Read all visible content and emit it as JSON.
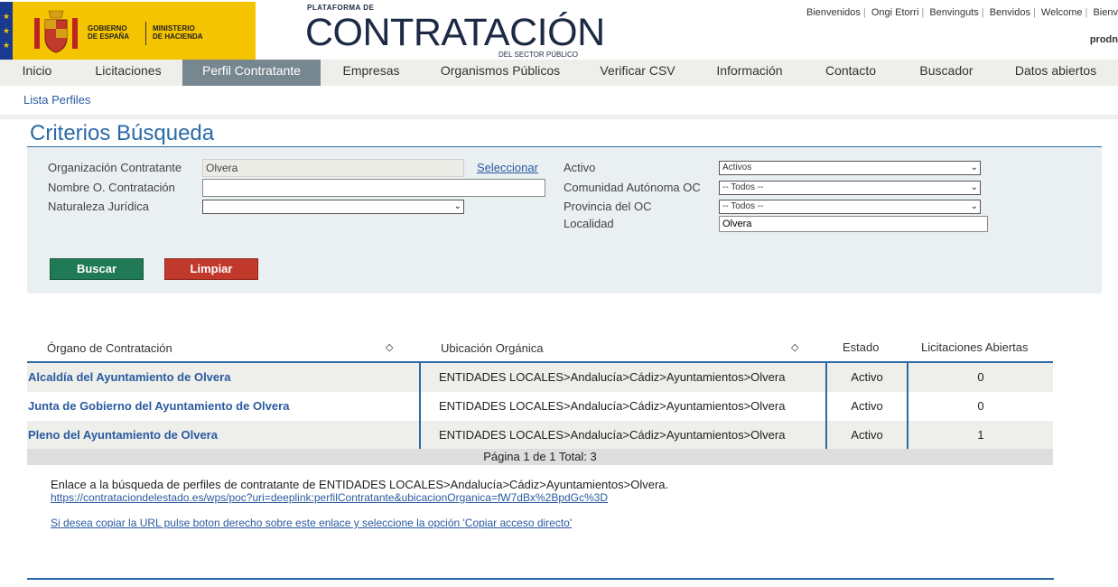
{
  "header": {
    "gov_line1": "GOBIERNO",
    "gov_line2": "DE ESPAÑA",
    "min_line1": "MINISTERIO",
    "min_line2": "DE HACIENDA",
    "brand_top": "PLATAFORMA DE",
    "brand_main": "CONTRATACIÓN",
    "brand_bottom": "DEL SECTOR PÚBLICO",
    "languages": [
      "Bienvenidos",
      "Ongi Etorri",
      "Benvinguts",
      "Benvidos",
      "Welcome",
      "Bienv"
    ],
    "user": "prodn"
  },
  "nav": {
    "items": [
      "Inicio",
      "Licitaciones",
      "Perfil Contratante",
      "Empresas",
      "Organismos Públicos",
      "Verificar CSV",
      "Información",
      "Contacto",
      "Buscador",
      "Datos abiertos"
    ],
    "active": "Perfil Contratante"
  },
  "subnav": {
    "link": "Lista Perfiles"
  },
  "criteria": {
    "title": "Criterios Búsqueda",
    "org_label": "Organización Contratante",
    "org_value": "Olvera",
    "select_link": "Seleccionar",
    "nombre_label": "Nombre O. Contratación",
    "nombre_value": "",
    "naturaleza_label": "Naturaleza Jurídica",
    "naturaleza_value": "",
    "activo_label": "Activo",
    "activo_value": "Activos",
    "comunidad_label": "Comunidad Autónoma OC",
    "comunidad_value": "-- Todos --",
    "provincia_label": "Provincia del OC",
    "provincia_value": "-- Todos --",
    "localidad_label": "Localidad",
    "localidad_value": "Olvera",
    "buscar": "Buscar",
    "limpiar": "Limpiar"
  },
  "table": {
    "headers": {
      "organo": "Órgano de Contratación",
      "ubicacion": "Ubicación Orgánica",
      "estado": "Estado",
      "licitaciones": "Licitaciones Abiertas"
    },
    "rows": [
      {
        "organo": "Alcaldía del Ayuntamiento de Olvera",
        "ubicacion": "ENTIDADES LOCALES>Andalucía>Cádiz>Ayuntamientos>Olvera",
        "estado": "Activo",
        "licitaciones": "0"
      },
      {
        "organo": "Junta de Gobierno del Ayuntamiento de Olvera",
        "ubicacion": "ENTIDADES LOCALES>Andalucía>Cádiz>Ayuntamientos>Olvera",
        "estado": "Activo",
        "licitaciones": "0"
      },
      {
        "organo": "Pleno del Ayuntamiento de Olvera",
        "ubicacion": "ENTIDADES LOCALES>Andalucía>Cádiz>Ayuntamientos>Olvera",
        "estado": "Activo",
        "licitaciones": "1"
      }
    ],
    "pager": "Página  1  de  1  Total:  3"
  },
  "info": {
    "text": "Enlace a la búsqueda de perfiles de contratante de ENTIDADES LOCALES>Andalucía>Cádiz>Ayuntamientos>Olvera.",
    "link": "https://contrataciondelestado.es/wps/poc?uri=deeplink:perfilContratante&ubicacionOrganica=fW7dBx%2BpdGc%3D",
    "copy_hint": "Si desea copiar la URL pulse boton derecho sobre este enlace y seleccione la opción 'Copiar acceso directo'"
  }
}
